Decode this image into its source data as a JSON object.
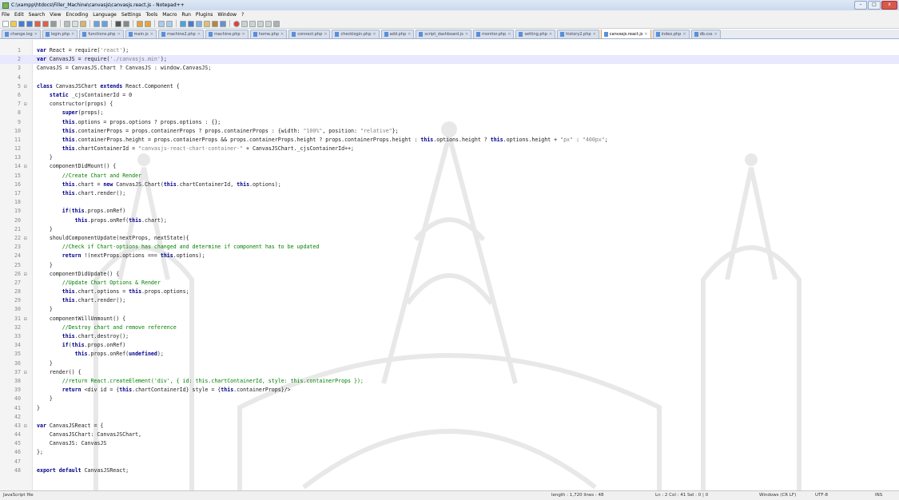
{
  "window": {
    "title": "C:\\xampp\\htdocs\\Filler_Machine\\canvasjs\\canvasjs.react.js - Notepad++",
    "buttons": [
      "–",
      "□",
      "x"
    ]
  },
  "menu": [
    "File",
    "Edit",
    "Search",
    "View",
    "Encoding",
    "Language",
    "Settings",
    "Tools",
    "Macro",
    "Run",
    "Plugins",
    "Window",
    "?"
  ],
  "tabs": [
    {
      "label": "change.log",
      "active": false
    },
    {
      "label": "login.php",
      "active": false
    },
    {
      "label": "functions.php",
      "active": false
    },
    {
      "label": "main.js",
      "active": false
    },
    {
      "label": "machine2.php",
      "active": false
    },
    {
      "label": "machine.php",
      "active": false
    },
    {
      "label": "home.php",
      "active": false
    },
    {
      "label": "connect.php",
      "active": false
    },
    {
      "label": "checklogin.php",
      "active": false
    },
    {
      "label": "add.php",
      "active": false
    },
    {
      "label": "script_dashboard.js",
      "active": false
    },
    {
      "label": "monitor.php",
      "active": false
    },
    {
      "label": "setting.php",
      "active": false
    },
    {
      "label": "history2.php",
      "active": false
    },
    {
      "label": "canvasjs.react.js",
      "active": true
    },
    {
      "label": "index.php",
      "active": false
    },
    {
      "label": "db.css",
      "active": false
    }
  ],
  "editor": {
    "current_line": 2,
    "lines": [
      {
        "n": "1",
        "fold": "",
        "code": [
          {
            "t": "var ",
            "c": "k"
          },
          {
            "t": "React = require("
          },
          {
            "t": "'react'",
            "c": "s"
          },
          {
            "t": ");"
          }
        ]
      },
      {
        "n": "2",
        "fold": "",
        "code": [
          {
            "t": "var ",
            "c": "k"
          },
          {
            "t": "CanvasJS = require("
          },
          {
            "t": "'./canvasjs.min'",
            "c": "s"
          },
          {
            "t": ");"
          }
        ]
      },
      {
        "n": "3",
        "fold": "",
        "code": [
          {
            "t": "CanvasJS = CanvasJS.Chart ? CanvasJS : window.CanvasJS;"
          }
        ]
      },
      {
        "n": "4",
        "fold": "",
        "code": []
      },
      {
        "n": "5",
        "fold": "⊟",
        "code": [
          {
            "t": "class ",
            "c": "k"
          },
          {
            "t": "CanvasJSChart "
          },
          {
            "t": "extends ",
            "c": "k"
          },
          {
            "t": "React.Component {"
          }
        ]
      },
      {
        "n": "6",
        "fold": "",
        "code": [
          {
            "t": "    "
          },
          {
            "t": "static ",
            "c": "k"
          },
          {
            "t": "_cjsContainerId = 0"
          }
        ]
      },
      {
        "n": "7",
        "fold": "⊟",
        "code": [
          {
            "t": "    constructor(props) {"
          }
        ]
      },
      {
        "n": "8",
        "fold": "",
        "code": [
          {
            "t": "        "
          },
          {
            "t": "super",
            "c": "k"
          },
          {
            "t": "(props);"
          }
        ]
      },
      {
        "n": "9",
        "fold": "",
        "code": [
          {
            "t": "        "
          },
          {
            "t": "this",
            "c": "k"
          },
          {
            "t": ".options = props.options ? props.options : {};"
          }
        ]
      },
      {
        "n": "10",
        "fold": "",
        "code": [
          {
            "t": "        "
          },
          {
            "t": "this",
            "c": "k"
          },
          {
            "t": ".containerProps = props.containerProps ? props.containerProps : {width: "
          },
          {
            "t": "\"100%\"",
            "c": "s"
          },
          {
            "t": ", position: "
          },
          {
            "t": "\"relative\"",
            "c": "s"
          },
          {
            "t": "};"
          }
        ]
      },
      {
        "n": "11",
        "fold": "",
        "code": [
          {
            "t": "        "
          },
          {
            "t": "this",
            "c": "k"
          },
          {
            "t": ".containerProps.height = props.containerProps && props.containerProps.height ? props.containerProps.height : "
          },
          {
            "t": "this",
            "c": "k"
          },
          {
            "t": ".options.height ? "
          },
          {
            "t": "this",
            "c": "k"
          },
          {
            "t": ".options.height + "
          },
          {
            "t": "\"px\"",
            "c": "s"
          },
          {
            "t": " : "
          },
          {
            "t": "\"400px\"",
            "c": "s"
          },
          {
            "t": ";"
          }
        ]
      },
      {
        "n": "12",
        "fold": "",
        "code": [
          {
            "t": "        "
          },
          {
            "t": "this",
            "c": "k"
          },
          {
            "t": ".chartContainerId = "
          },
          {
            "t": "\"canvasjs-react-chart-container-\"",
            "c": "s"
          },
          {
            "t": " + CanvasJSChart._cjsContainerId++;"
          }
        ]
      },
      {
        "n": "13",
        "fold": "",
        "code": [
          {
            "t": "    }"
          }
        ]
      },
      {
        "n": "14",
        "fold": "⊟",
        "code": [
          {
            "t": "    componentDidMount() {"
          }
        ]
      },
      {
        "n": "15",
        "fold": "",
        "code": [
          {
            "t": "        "
          },
          {
            "t": "//Create Chart and Render",
            "c": "c"
          }
        ]
      },
      {
        "n": "16",
        "fold": "",
        "code": [
          {
            "t": "        "
          },
          {
            "t": "this",
            "c": "k"
          },
          {
            "t": ".chart = "
          },
          {
            "t": "new ",
            "c": "k"
          },
          {
            "t": "CanvasJS.Chart("
          },
          {
            "t": "this",
            "c": "k"
          },
          {
            "t": ".chartContainerId, "
          },
          {
            "t": "this",
            "c": "k"
          },
          {
            "t": ".options);"
          }
        ]
      },
      {
        "n": "17",
        "fold": "",
        "code": [
          {
            "t": "        "
          },
          {
            "t": "this",
            "c": "k"
          },
          {
            "t": ".chart.render();"
          }
        ]
      },
      {
        "n": "18",
        "fold": "",
        "code": []
      },
      {
        "n": "19",
        "fold": "",
        "code": [
          {
            "t": "        "
          },
          {
            "t": "if",
            "c": "k"
          },
          {
            "t": "("
          },
          {
            "t": "this",
            "c": "k"
          },
          {
            "t": ".props.onRef)"
          }
        ]
      },
      {
        "n": "20",
        "fold": "",
        "code": [
          {
            "t": "            "
          },
          {
            "t": "this",
            "c": "k"
          },
          {
            "t": ".props.onRef("
          },
          {
            "t": "this",
            "c": "k"
          },
          {
            "t": ".chart);"
          }
        ]
      },
      {
        "n": "21",
        "fold": "",
        "code": [
          {
            "t": "    }"
          }
        ]
      },
      {
        "n": "22",
        "fold": "⊟",
        "code": [
          {
            "t": "    shouldComponentUpdate(nextProps, nextState){"
          }
        ]
      },
      {
        "n": "23",
        "fold": "",
        "code": [
          {
            "t": "        "
          },
          {
            "t": "//Check if Chart-options has changed and determine if component has to be updated",
            "c": "c"
          }
        ]
      },
      {
        "n": "24",
        "fold": "",
        "code": [
          {
            "t": "        "
          },
          {
            "t": "return ",
            "c": "k"
          },
          {
            "t": "!(nextProps.options === "
          },
          {
            "t": "this",
            "c": "k"
          },
          {
            "t": ".options);"
          }
        ]
      },
      {
        "n": "25",
        "fold": "",
        "code": [
          {
            "t": "    }"
          }
        ]
      },
      {
        "n": "26",
        "fold": "⊟",
        "code": [
          {
            "t": "    componentDidUpdate() {"
          }
        ]
      },
      {
        "n": "27",
        "fold": "",
        "code": [
          {
            "t": "        "
          },
          {
            "t": "//Update Chart Options & Render",
            "c": "c"
          }
        ]
      },
      {
        "n": "28",
        "fold": "",
        "code": [
          {
            "t": "        "
          },
          {
            "t": "this",
            "c": "k"
          },
          {
            "t": ".chart.options = "
          },
          {
            "t": "this",
            "c": "k"
          },
          {
            "t": ".props.options;"
          }
        ]
      },
      {
        "n": "29",
        "fold": "",
        "code": [
          {
            "t": "        "
          },
          {
            "t": "this",
            "c": "k"
          },
          {
            "t": ".chart.render();"
          }
        ]
      },
      {
        "n": "30",
        "fold": "",
        "code": [
          {
            "t": "    }"
          }
        ]
      },
      {
        "n": "31",
        "fold": "⊟",
        "code": [
          {
            "t": "    componentWillUnmount() {"
          }
        ]
      },
      {
        "n": "32",
        "fold": "",
        "code": [
          {
            "t": "        "
          },
          {
            "t": "//Destroy chart and remove reference",
            "c": "c"
          }
        ]
      },
      {
        "n": "33",
        "fold": "",
        "code": [
          {
            "t": "        "
          },
          {
            "t": "this",
            "c": "k"
          },
          {
            "t": ".chart.destroy();"
          }
        ]
      },
      {
        "n": "34",
        "fold": "",
        "code": [
          {
            "t": "        "
          },
          {
            "t": "if",
            "c": "k"
          },
          {
            "t": "("
          },
          {
            "t": "this",
            "c": "k"
          },
          {
            "t": ".props.onRef)"
          }
        ]
      },
      {
        "n": "35",
        "fold": "",
        "code": [
          {
            "t": "            "
          },
          {
            "t": "this",
            "c": "k"
          },
          {
            "t": ".props.onRef("
          },
          {
            "t": "undefined",
            "c": "k"
          },
          {
            "t": ");"
          }
        ]
      },
      {
        "n": "36",
        "fold": "",
        "code": [
          {
            "t": "    }"
          }
        ]
      },
      {
        "n": "37",
        "fold": "⊟",
        "code": [
          {
            "t": "    render() {"
          }
        ]
      },
      {
        "n": "38",
        "fold": "",
        "code": [
          {
            "t": "        "
          },
          {
            "t": "//return React.createElement('div', { id: this.chartContainerId, style: this.containerProps });",
            "c": "c"
          }
        ]
      },
      {
        "n": "39",
        "fold": "",
        "code": [
          {
            "t": "        "
          },
          {
            "t": "return ",
            "c": "k"
          },
          {
            "t": "<div id = {"
          },
          {
            "t": "this",
            "c": "k"
          },
          {
            "t": ".chartContainerId} style = {"
          },
          {
            "t": "this",
            "c": "k"
          },
          {
            "t": ".containerProps}/>"
          }
        ]
      },
      {
        "n": "40",
        "fold": "",
        "code": [
          {
            "t": "    }"
          }
        ]
      },
      {
        "n": "41",
        "fold": "",
        "code": [
          {
            "t": "}"
          }
        ]
      },
      {
        "n": "42",
        "fold": "",
        "code": []
      },
      {
        "n": "43",
        "fold": "⊟",
        "code": [
          {
            "t": "var ",
            "c": "k"
          },
          {
            "t": "CanvasJSReact = {"
          }
        ]
      },
      {
        "n": "44",
        "fold": "",
        "code": [
          {
            "t": "    CanvasJSChart: CanvasJSChart,"
          }
        ]
      },
      {
        "n": "45",
        "fold": "",
        "code": [
          {
            "t": "    CanvasJS: CanvasJS"
          }
        ]
      },
      {
        "n": "46",
        "fold": "",
        "code": [
          {
            "t": "};"
          }
        ]
      },
      {
        "n": "47",
        "fold": "",
        "code": []
      },
      {
        "n": "48",
        "fold": "",
        "code": [
          {
            "t": "export ",
            "c": "k"
          },
          {
            "t": "default ",
            "c": "k"
          },
          {
            "t": "CanvasJSReact;"
          }
        ]
      }
    ]
  },
  "status": {
    "filetype": "JavaScript file",
    "length": "length : 1,720    lines : 48",
    "position": "Ln : 2    Col : 41    Sel : 0 | 0",
    "eol": "Windows (CR LF)",
    "encoding": "UTF-8",
    "mode": "INS"
  },
  "colors": {
    "keyword": "#00008b",
    "string": "#808080",
    "comment": "#008000",
    "active_tab_accent": "#f0a040",
    "current_line": "#e8e8ff"
  }
}
